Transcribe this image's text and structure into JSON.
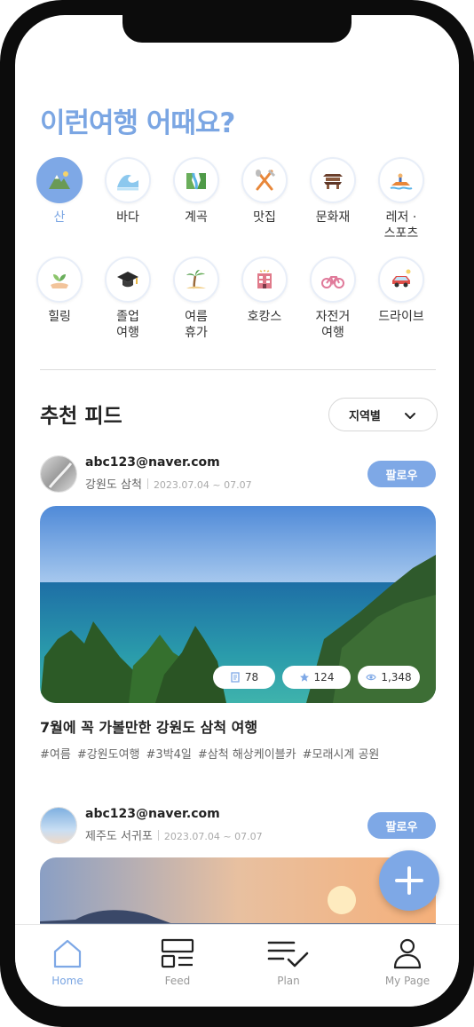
{
  "headline": "이런여행 어때요?",
  "categories": [
    {
      "label": "산",
      "icon": "mountain-icon",
      "active": true
    },
    {
      "label": "바다",
      "icon": "wave-icon"
    },
    {
      "label": "계곡",
      "icon": "valley-icon"
    },
    {
      "label": "맛집",
      "icon": "utensils-icon"
    },
    {
      "label": "문화재",
      "icon": "heritage-icon"
    },
    {
      "label": "레저 ·\n스포츠",
      "icon": "jet-ski-icon"
    },
    {
      "label": "힐링",
      "icon": "healing-icon"
    },
    {
      "label": "졸업\n여행",
      "icon": "graduation-cap-icon"
    },
    {
      "label": "여름\n휴가",
      "icon": "palm-tree-icon"
    },
    {
      "label": "호캉스",
      "icon": "hotel-icon"
    },
    {
      "label": "자전거\n여행",
      "icon": "bicycle-icon"
    },
    {
      "label": "드라이브",
      "icon": "car-icon"
    }
  ],
  "feed": {
    "title": "추천 피드",
    "region_select": "지역별"
  },
  "posts": [
    {
      "email": "abc123@naver.com",
      "location": "강원도 삼척",
      "dates": "2023.07.04 ~ 07.07",
      "follow": "팔로우",
      "stats": {
        "posts": "78",
        "stars": "124",
        "views": "1,348"
      },
      "title": "7월에 꼭 가볼만한 강원도 삼척 여행",
      "tags": [
        "#여름",
        "#강원도여행",
        "#3박4일",
        "#삼척 해상케이블카",
        "#모래시계 공원"
      ]
    },
    {
      "email": "abc123@naver.com",
      "location": "제주도 서귀포",
      "dates": "2023.07.04 ~ 07.07",
      "follow": "팔로우"
    }
  ],
  "nav": [
    {
      "label": "Home",
      "icon": "home-icon",
      "active": true
    },
    {
      "label": "Feed",
      "icon": "feed-icon"
    },
    {
      "label": "Plan",
      "icon": "plan-icon"
    },
    {
      "label": "My Page",
      "icon": "user-icon"
    }
  ],
  "colors": {
    "accent": "#7ea8e6",
    "headline": "#7ba6e3",
    "text": "#222222"
  }
}
